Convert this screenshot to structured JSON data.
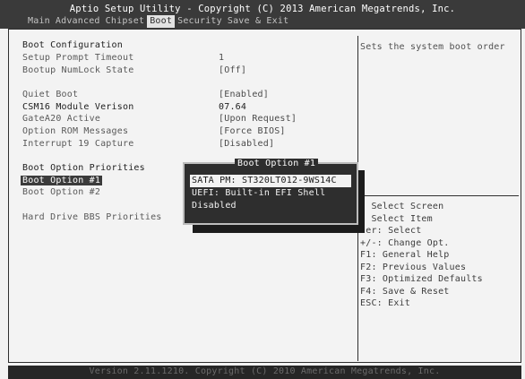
{
  "header": {
    "title": "Aptio Setup Utility - Copyright (C) 2013 American Megatrends, Inc.",
    "tabs": [
      {
        "label": "Main"
      },
      {
        "label": "Advanced"
      },
      {
        "label": "Chipset"
      },
      {
        "label": "Boot",
        "active": true
      },
      {
        "label": "Security"
      },
      {
        "label": "Save & Exit"
      }
    ]
  },
  "settings": {
    "boot_configuration": "Boot Configuration",
    "setup_prompt_timeout": {
      "label": "Setup Prompt Timeout",
      "value": "1"
    },
    "bootup_numlock_state": {
      "label": "Bootup NumLock State",
      "value": "[Off]"
    },
    "quiet_boot": {
      "label": "Quiet Boot",
      "value": "[Enabled]"
    },
    "csm16_version": {
      "label": "CSM16 Module Verison",
      "value": "07.64"
    },
    "gatea20_active": {
      "label": "GateA20 Active",
      "value": "[Upon Request]"
    },
    "option_rom_messages": {
      "label": "Option ROM Messages",
      "value": "[Force BIOS]"
    },
    "interrupt_19_capture": {
      "label": "Interrupt 19 Capture",
      "value": "[Disabled]"
    },
    "boot_option_priorities": "Boot Option Priorities",
    "boot_option_1": {
      "label": "Boot Option #1"
    },
    "boot_option_2": {
      "label": "Boot Option #2"
    },
    "hard_drive_bbs": {
      "label": "Hard Drive BBS Priorities"
    }
  },
  "popup": {
    "title": "Boot Option #1",
    "options": [
      "SATA  PM: ST320LT012-9WS14C",
      "UEFI: Built-in EFI Shell",
      "Disabled"
    ],
    "selected_index": 0
  },
  "help": {
    "text": "Sets the system boot order",
    "keys": [
      ": Select Screen",
      ": Select Item",
      "ter: Select",
      "+/-: Change Opt.",
      "F1: General Help",
      "F2: Previous Values",
      "F3: Optimized Defaults",
      "F4: Save & Reset",
      "ESC: Exit"
    ]
  },
  "footer": {
    "text": "Version 2.11.1210. Copyright (C) 2010 American Megatrends, Inc."
  },
  "colors": {
    "header_bg": "#3a3a3a",
    "popup_bg": "#2e2e2e",
    "selection_bg": "#3b3b3b",
    "background": "#f2f2f2"
  }
}
